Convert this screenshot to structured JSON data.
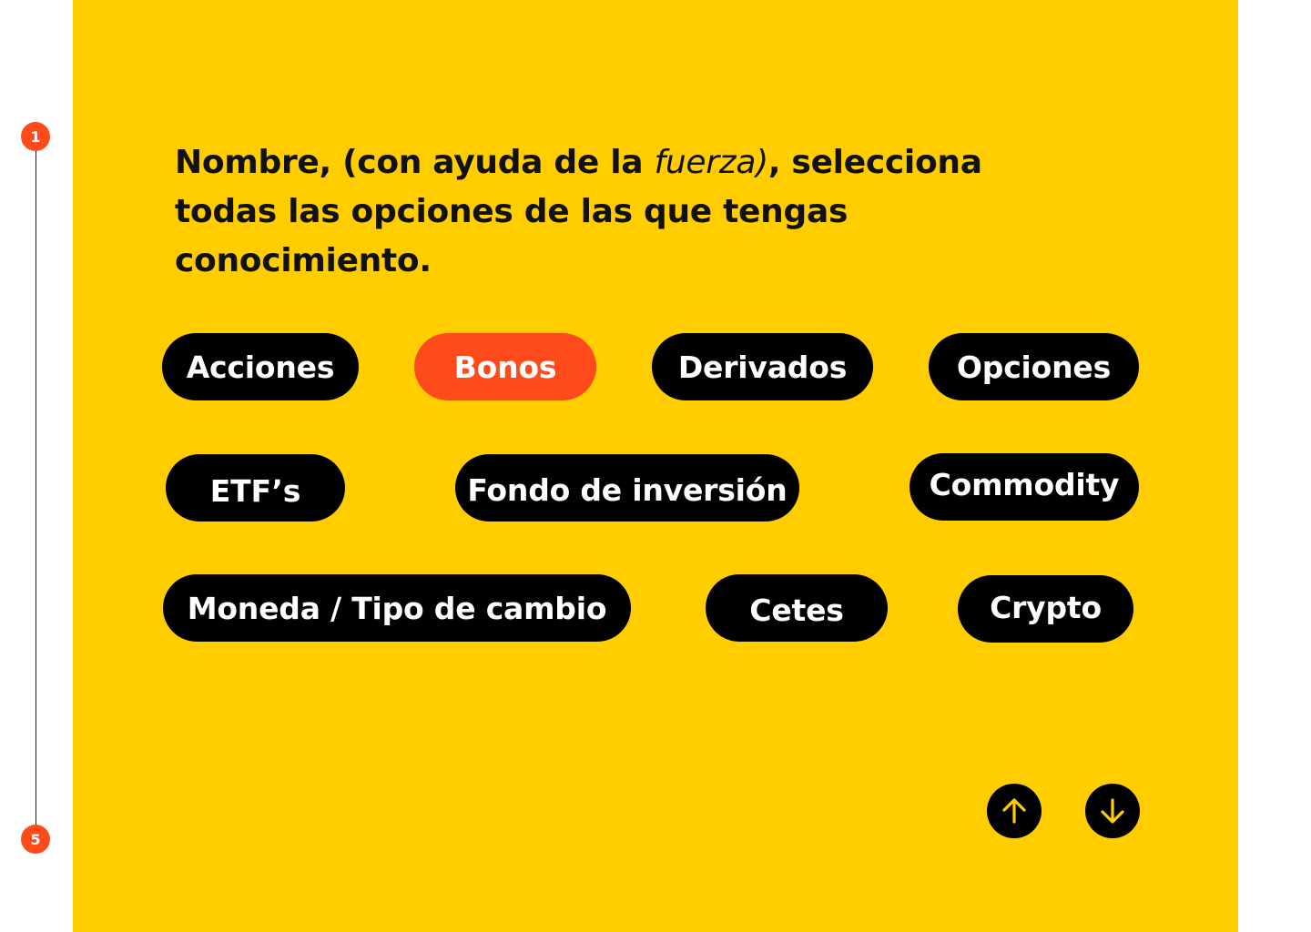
{
  "progress": {
    "first_step": "1",
    "last_step": "5"
  },
  "question": {
    "text_before": "Nombre, (con ayuda de la ",
    "text_italic": "fuerza)",
    "text_after": ", selecciona todas las opciones de las que tengas conocimiento."
  },
  "options": [
    {
      "label": "Acciones",
      "selected": false
    },
    {
      "label": "Bonos",
      "selected": true
    },
    {
      "label": "Derivados",
      "selected": false
    },
    {
      "label": "Opciones",
      "selected": false
    },
    {
      "label": "ETF’s",
      "selected": false
    },
    {
      "label": "Fondo de inversión",
      "selected": false
    },
    {
      "label": "Commodity",
      "selected": false
    },
    {
      "label": "Moneda / Tipo de cambio",
      "selected": false
    },
    {
      "label": "Cetes",
      "selected": false
    },
    {
      "label": "Crypto",
      "selected": false
    }
  ],
  "navigation": {
    "up_icon": "arrow-up-icon",
    "down_icon": "arrow-down-icon"
  },
  "colors": {
    "background": "#ffcd00",
    "chip": "#000000",
    "chip_selected": "#ff4a1c",
    "step_dot": "#ff4a1c",
    "nav_icon": "#ffcd00"
  }
}
